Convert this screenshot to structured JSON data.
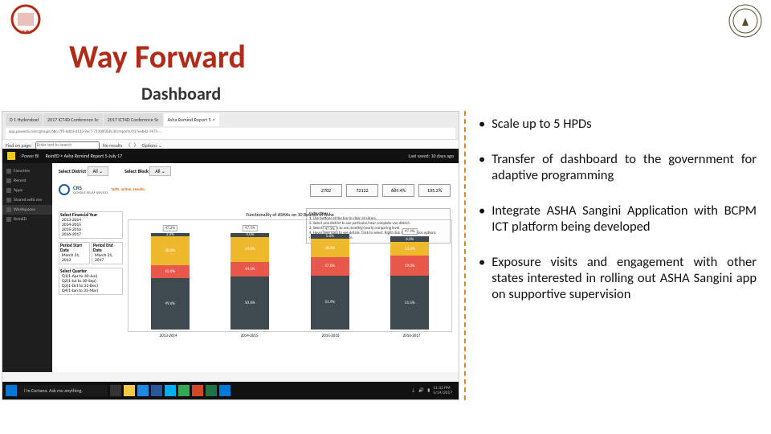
{
  "logos": {
    "left_alt": "NHM logo",
    "right_alt": "UP Government seal"
  },
  "title": "Way Forward",
  "subtitle": "Dashboard",
  "bullets": [
    "Scale up to 5 HPDs",
    "Transfer of dashboard to the government for adaptive programming",
    "Integrate ASHA Sangini Application with BCPM ICT platform being developed",
    "Exposure visits and engagement with other states interested in rolling out ASHA Sangini app on supportive supervision"
  ],
  "browser": {
    "tabs": [
      "D 1 Hyderabad",
      "2017 ICT4D Conference Sc",
      "2017 ICT4D Conference Sc",
      "Asha Remind Report 5"
    ],
    "active_tab": 3,
    "address": "app.powerbi.com/groups/68cc7f0-dd03-d132-9ec7-71106f2b0c30/reports/017eeb42-3475-...",
    "find": {
      "label": "Find on page:",
      "placeholder": "Enter text to search",
      "noresults": "No results",
      "options": "Options ⌄"
    }
  },
  "powerbi": {
    "brand": "Power BI",
    "breadcrumb": "ReinED > Asha Remind Report 5-July 17",
    "last_saved": "Last saved: 10 days ago",
    "sidebar": [
      "Favorites",
      "Recent",
      "Apps",
      "Shared with me",
      "Workspaces",
      "ReinED"
    ],
    "sidebar_selected": 4,
    "header": {
      "select_district": "Select District",
      "select_block": "Select Block"
    },
    "metrics": [
      "2702",
      "72122",
      "689.4%",
      "105.2%"
    ],
    "org": {
      "name": "CRS",
      "tag": "faith. action. results.",
      "sub": "CATHOLIC RELIEF SERVICES"
    },
    "instructions_title": "Instructions",
    "instructions": [
      "1. Use buttons at the top to clear all slicers.",
      "2. Select one district to see particular/near complete van district.",
      "3. Select one block to see monthly/yearly comparing level.",
      "4. Hover over data to see details. Click to select. Right click to access slice options related to change in service."
    ],
    "filters": {
      "fy_label": "Select Financial Year",
      "fy_options": [
        "2013-2014",
        "2014-2015",
        "2015-2016",
        "2016-2017"
      ],
      "period_start_label": "Period Start Date",
      "period_start": "March 31, 2013",
      "period_end_label": "Period End Date",
      "period_end": "March 31, 2017",
      "quarter_label": "Select Quarter",
      "quarter_options": [
        "Q1(1-Apr to 30-Jun)",
        "Q2(1-Jul to 30-Sep)",
        "Q3(1-Oct to 31-Dec)",
        "Q4(1-Jan to 31-Mar)"
      ]
    }
  },
  "chart_data": {
    "type": "bar",
    "title": "Functionality of ASHAs on 10 Rounds of Asha",
    "categories": [
      "2013-2014",
      "2014-2015",
      "2015-2016",
      "2016-2017"
    ],
    "stack_keys": [
      "segA",
      "segB",
      "segC",
      "segD"
    ],
    "colors": {
      "segA": "#3e4a50",
      "segB": "#e8594b",
      "segC": "#efb92e",
      "segD": "#3e4a50"
    },
    "top_badges": [
      "47.2%",
      "47.5%",
      "47.9%",
      "47.9%"
    ],
    "series": [
      {
        "segA": 49.6,
        "segB": 12.0,
        "segC": 28.0,
        "segD": 3.0
      },
      {
        "segA": 50.6,
        "segB": 14.0,
        "segC": 24.0,
        "segD": 4.0
      },
      {
        "segA": 51.9,
        "segB": 17.0,
        "segC": 18.0,
        "segD": 5.0
      },
      {
        "segA": 51.5,
        "segB": 19.0,
        "segC": 13.0,
        "segD": 6.0
      }
    ],
    "ylim": [
      0,
      100
    ]
  },
  "taskbar": {
    "cortana": "I'm Cortana. Ask me anything.",
    "time": "11:32 PM",
    "date": "5/14/2017"
  }
}
